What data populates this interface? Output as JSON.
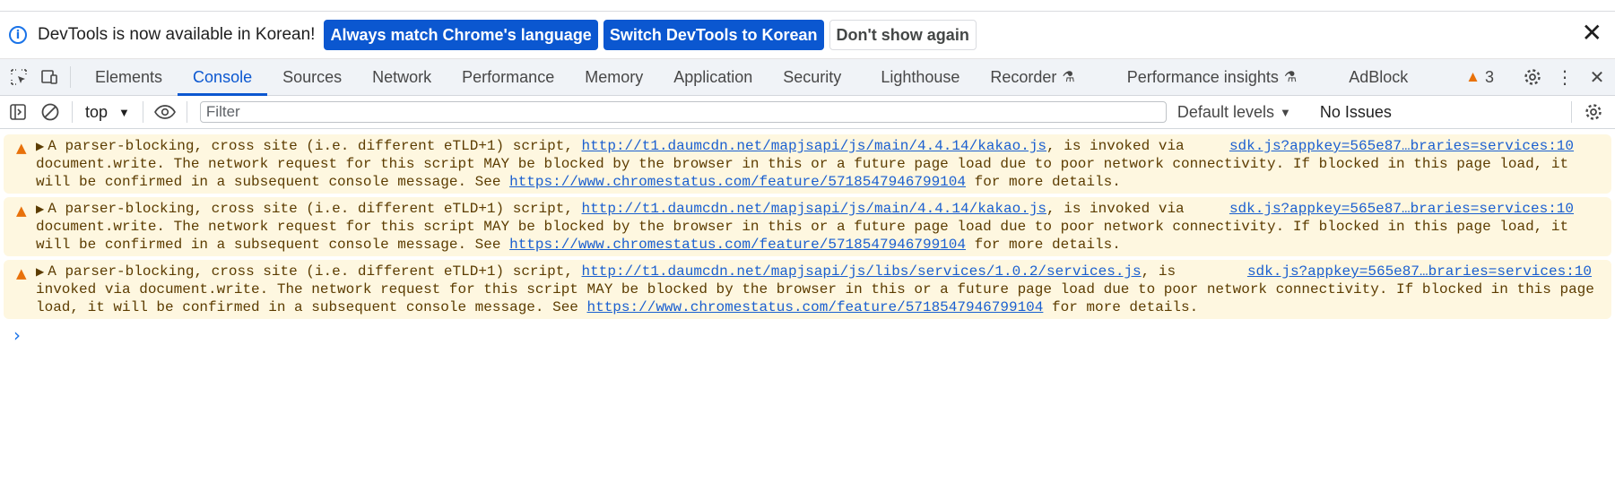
{
  "infobar": {
    "message": "DevTools is now available in Korean!",
    "btn_always_match": "Always match Chrome's language",
    "btn_switch": "Switch DevTools to Korean",
    "btn_dont_show": "Don't show again",
    "close_icon": "close-icon",
    "info_icon": "info-icon"
  },
  "tabs": {
    "elements": "Elements",
    "console": "Console",
    "sources": "Sources",
    "network": "Network",
    "performance": "Performance",
    "memory": "Memory",
    "application": "Application",
    "security": "Security",
    "lighthouse": "Lighthouse",
    "recorder": "Recorder",
    "performance_insights": "Performance insights",
    "adblock": "AdBlock",
    "active": "Console"
  },
  "tabbar_right": {
    "warning_count": "3"
  },
  "console_toolbar": {
    "context": "top",
    "filter_placeholder": "Filter",
    "levels": "Default levels",
    "issues": "No Issues"
  },
  "messages": [
    {
      "source": "sdk.js?appkey=565e87…braries=services:10",
      "text_before": "A parser-blocking, cross site (i.e. different eTLD+1) script, ",
      "script_url": "http://t1.daumcdn.net/mapjsapi/js/main/4.4.14/kakao.js",
      "text_middle": ", is invoked via document.write. The network request for this script MAY be blocked by the browser in this or a future page load due to poor network connectivity. If blocked in this page load, it will be confirmed in a subsequent console message. See ",
      "feature_url": "https://www.chromestatus.com/feature/5718547946799104",
      "text_after": " for more details."
    },
    {
      "source": "sdk.js?appkey=565e87…braries=services:10",
      "text_before": "A parser-blocking, cross site (i.e. different eTLD+1) script, ",
      "script_url": "http://t1.daumcdn.net/mapjsapi/js/main/4.4.14/kakao.js",
      "text_middle": ", is invoked via document.write. The network request for this script MAY be blocked by the browser in this or a future page load due to poor network connectivity. If blocked in this page load, it will be confirmed in a subsequent console message. See ",
      "feature_url": "https://www.chromestatus.com/feature/5718547946799104",
      "text_after": " for more details."
    },
    {
      "source": "sdk.js?appkey=565e87…braries=services:10",
      "text_before": "A parser-blocking, cross site (i.e. different eTLD+1) script, ",
      "script_url": "http://t1.daumcdn.net/mapjsapi/js/libs/services/1.0.2/services.js",
      "text_middle": ", is invoked via document.write. The network request for this script MAY be blocked by the browser in this or a future page load due to poor network connectivity. If blocked in this page load, it will be confirmed in a subsequent console message. See ",
      "feature_url": "https://www.chromestatus.com/feature/5718547946799104",
      "text_after": " for more details."
    }
  ],
  "prompt_symbol": "›"
}
